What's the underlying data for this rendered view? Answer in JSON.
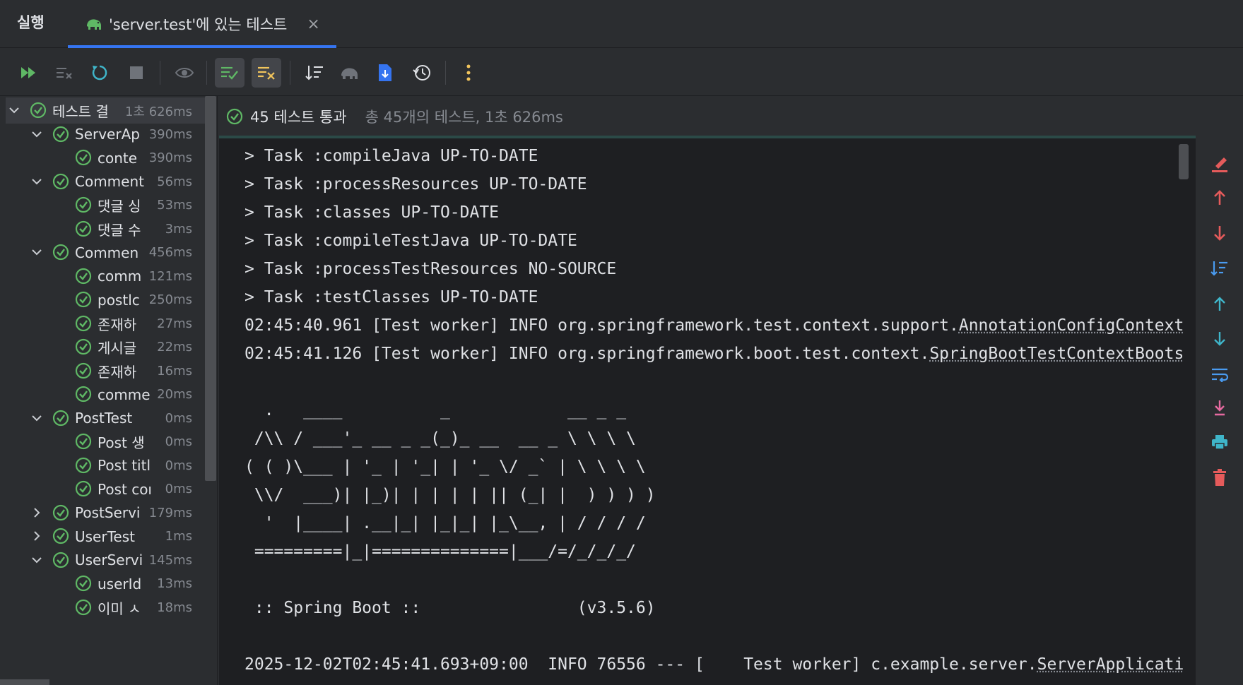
{
  "tabs": {
    "run_label": "실행",
    "active_label": "'server.test'에 있는 테스트",
    "close_glyph": "×"
  },
  "toolbar": {
    "buttons": [
      "rerun-failed",
      "cancel",
      "rerun",
      "stop",
      "show-passed",
      "show-ignored",
      "sort",
      "gradle",
      "import-tests",
      "history",
      "more"
    ]
  },
  "summary": {
    "passed": "45 테스트 통과",
    "total": "총 45개의 테스트, 1초 626ms"
  },
  "tree": [
    {
      "name": "테스트 결",
      "time": "1초 626ms",
      "level": 0,
      "expanded": true
    },
    {
      "name": "ServerAp",
      "time": "390ms",
      "level": 1,
      "expanded": true
    },
    {
      "name": "conte",
      "time": "390ms",
      "level": 2
    },
    {
      "name": "Comment",
      "time": "56ms",
      "level": 1,
      "expanded": true
    },
    {
      "name": "댓글 싱",
      "time": "53ms",
      "level": 2
    },
    {
      "name": "댓글 수",
      "time": "3ms",
      "level": 2
    },
    {
      "name": "Commen",
      "time": "456ms",
      "level": 1,
      "expanded": true
    },
    {
      "name": "comm",
      "time": "121ms",
      "level": 2
    },
    {
      "name": "postlc",
      "time": "250ms",
      "level": 2
    },
    {
      "name": "존재하",
      "time": "27ms",
      "level": 2
    },
    {
      "name": "게시글",
      "time": "22ms",
      "level": 2
    },
    {
      "name": "존재하",
      "time": "16ms",
      "level": 2
    },
    {
      "name": "comme",
      "time": "20ms",
      "level": 2
    },
    {
      "name": "PostTest",
      "time": "0ms",
      "level": 1,
      "expanded": true
    },
    {
      "name": "Post 생",
      "time": "0ms",
      "level": 2
    },
    {
      "name": "Post titl",
      "time": "0ms",
      "level": 2
    },
    {
      "name": "Post coı",
      "time": "0ms",
      "level": 2
    },
    {
      "name": "PostServi",
      "time": "179ms",
      "level": 1,
      "expanded": false
    },
    {
      "name": "UserTest",
      "time": "1ms",
      "level": 1,
      "expanded": false
    },
    {
      "name": "UserServi",
      "time": "145ms",
      "level": 1,
      "expanded": true
    },
    {
      "name": "userId",
      "time": "13ms",
      "level": 2
    },
    {
      "name": "이미 ㅅ",
      "time": "18ms",
      "level": 2
    }
  ],
  "console": {
    "lines": [
      "> Task :compileJava UP-TO-DATE",
      "> Task :processResources UP-TO-DATE",
      "> Task :classes UP-TO-DATE",
      "> Task :compileTestJava UP-TO-DATE",
      "> Task :processTestResources NO-SOURCE",
      "> Task :testClasses UP-TO-DATE"
    ],
    "log1_prefix": "02:45:40.961 [Test worker] INFO org.springframework.test.context.support.",
    "log1_link": "AnnotationConfigContext",
    "log2_prefix": "02:45:41.126 [Test worker] INFO org.springframework.boot.test.context.",
    "log2_link": "SpringBootTestContextBoots",
    "banner": [
      "  .   ____          _            __ _ _",
      " /\\\\ / ___'_ __ _ _(_)_ __  __ _ \\ \\ \\ \\",
      "( ( )\\___ | '_ | '_| | '_ \\/ _` | \\ \\ \\ \\",
      " \\\\/  ___)| |_)| | | | | || (_| |  ) ) ) )",
      "  '  |____| .__|_| |_|_| |_\\__, | / / / /",
      " =========|_|==============|___/=/_/_/_/"
    ],
    "spring_line": " :: Spring Boot ::                (v3.5.6)",
    "last_prefix": "2025-12-02T02:45:41.693+09:00  INFO 76556 --- [    Test worker] c.example.server.",
    "last_link": "ServerApplicati"
  },
  "colors": {
    "pass_green": "#5fb865",
    "accent_blue": "#3574f0",
    "yellow": "#f2c55c",
    "red": "#e55b5b",
    "cyan": "#3fb5c9"
  }
}
